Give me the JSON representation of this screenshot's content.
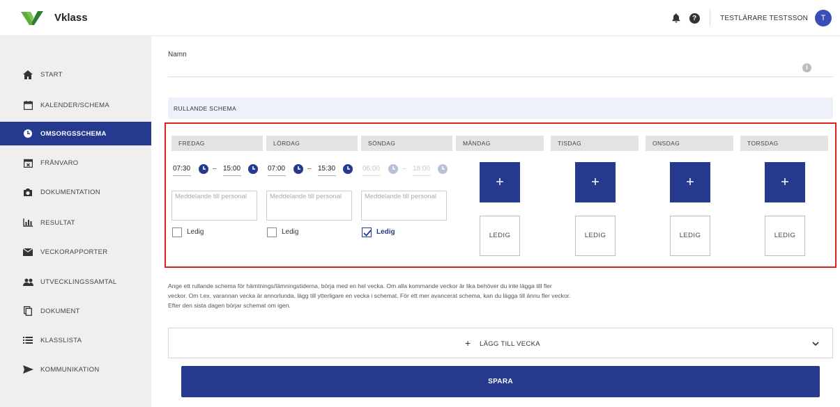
{
  "app": {
    "name": "Vklass"
  },
  "header": {
    "user_name": "TESTLÄRARE TESTSSON",
    "avatar_initial": "T",
    "bell_icon": "bell-icon",
    "help_icon": "help-icon",
    "help_glyph": "?"
  },
  "sidebar": {
    "items": [
      {
        "label": "START",
        "icon": "home-icon"
      },
      {
        "label": "KALENDER/SCHEMA",
        "icon": "calendar-icon"
      },
      {
        "label": "OMSORGSSCHEMA",
        "icon": "clock-icon",
        "active": true
      },
      {
        "label": "FRÅNVARO",
        "icon": "absence-calendar-icon"
      },
      {
        "label": "DOKUMENTATION",
        "icon": "camera-icon"
      },
      {
        "label": "RESULTAT",
        "icon": "bar-chart-icon"
      },
      {
        "label": "VECKORAPPORTER",
        "icon": "envelope-icon"
      },
      {
        "label": "UTVECKLINGSSAMTAL",
        "icon": "people-icon"
      },
      {
        "label": "DOKUMENT",
        "icon": "documents-icon"
      },
      {
        "label": "KLASSLISTA",
        "icon": "list-icon"
      },
      {
        "label": "KOMMUNIKATION",
        "icon": "send-icon"
      }
    ]
  },
  "form": {
    "name_label": "Namn",
    "info_glyph": "i",
    "rolling_title": "RULLANDE SCHEMA"
  },
  "schedule": {
    "days": [
      {
        "name": "FREDAG",
        "start": "07:30",
        "end": "15:00",
        "message_placeholder": "Meddelande till personal",
        "ledig_label": "Ledig",
        "ledig": false
      },
      {
        "name": "LÖRDAG",
        "start": "07:00",
        "end": "15:30",
        "message_placeholder": "Meddelande till personal",
        "ledig_label": "Ledig",
        "ledig": false
      },
      {
        "name": "SÖNDAG",
        "start": "06:00",
        "end": "18:00",
        "message_placeholder": "Meddelande till personal",
        "ledig_label": "Ledig",
        "ledig": true
      },
      {
        "name": "MÅNDAG",
        "add_label": "+",
        "ledig_button": "LEDIG"
      },
      {
        "name": "TISDAG",
        "add_label": "+",
        "ledig_button": "LEDIG"
      },
      {
        "name": "ONSDAG",
        "add_label": "+",
        "ledig_button": "LEDIG"
      },
      {
        "name": "TORSDAG",
        "add_label": "+",
        "ledig_button": "LEDIG"
      }
    ],
    "dash": "–"
  },
  "info_text": "Ange ett rullande schema för hämtnings/lämningstiderna, börja med en hel vecka. Om alla kommande veckor är lika behöver du inte lägga till fler veckor. Om t.ex. varannan vecka är annorlunda, lägg till ytterligare en vecka i schemat. För ett mer avancerat schema, kan du lägga till ännu fler veckor. Efter den sista dagen börjar schemat om igen.",
  "add_week": {
    "plus": "+",
    "label": "LÄGG TILL VECKA"
  },
  "save_label": "SPARA",
  "colors": {
    "primary": "#253a8e",
    "highlight_border": "#e0201d",
    "logo_green": "#5fae3c"
  }
}
